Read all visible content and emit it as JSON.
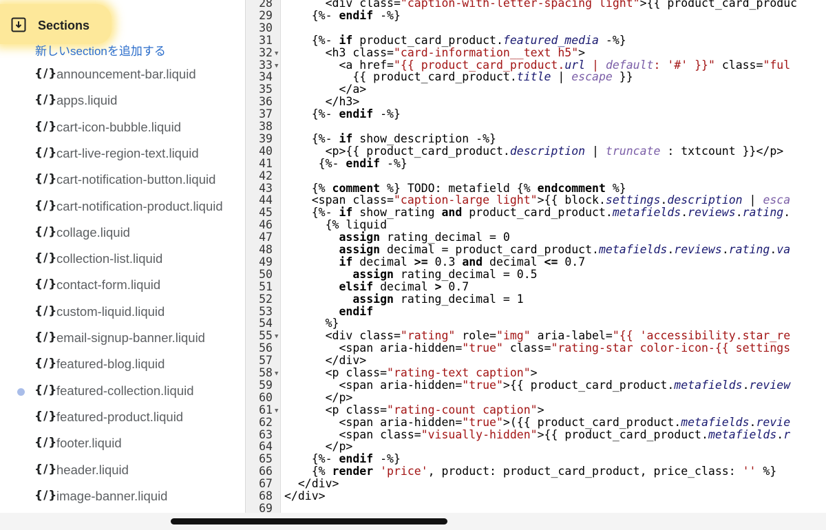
{
  "sidebar": {
    "title": "Sections",
    "add_link": "新しいsectionを追加する",
    "file_icon_text": "{/}",
    "files": [
      {
        "name": "announcement-bar.liquid",
        "modified": false
      },
      {
        "name": "apps.liquid",
        "modified": false
      },
      {
        "name": "cart-icon-bubble.liquid",
        "modified": false
      },
      {
        "name": "cart-live-region-text.liquid",
        "modified": false
      },
      {
        "name": "cart-notification-button.liquid",
        "modified": false
      },
      {
        "name": "cart-notification-product.liquid",
        "modified": false
      },
      {
        "name": "collage.liquid",
        "modified": false
      },
      {
        "name": "collection-list.liquid",
        "modified": false
      },
      {
        "name": "contact-form.liquid",
        "modified": false
      },
      {
        "name": "custom-liquid.liquid",
        "modified": false
      },
      {
        "name": "email-signup-banner.liquid",
        "modified": false
      },
      {
        "name": "featured-blog.liquid",
        "modified": false
      },
      {
        "name": "featured-collection.liquid",
        "modified": true
      },
      {
        "name": "featured-product.liquid",
        "modified": false
      },
      {
        "name": "footer.liquid",
        "modified": false
      },
      {
        "name": "header.liquid",
        "modified": false
      },
      {
        "name": "image-banner.liquid",
        "modified": false
      }
    ]
  },
  "editor": {
    "lines": [
      {
        "num": "28",
        "fold": false,
        "tokens": [
          [
            "pl",
            "      <div "
          ],
          [
            "pl",
            "class="
          ],
          [
            "str",
            "\"caption-with-letter-spacing light\""
          ],
          [
            "pl",
            ">{{ "
          ],
          [
            "pl",
            "product_card_produc"
          ]
        ]
      },
      {
        "num": "29",
        "fold": false,
        "tokens": [
          [
            "pl",
            "    {%- "
          ],
          [
            "kw",
            "endif"
          ],
          [
            "pl",
            " -%}"
          ]
        ]
      },
      {
        "num": "30",
        "fold": false,
        "tokens": []
      },
      {
        "num": "31",
        "fold": false,
        "tokens": [
          [
            "pl",
            "    {%- "
          ],
          [
            "kw",
            "if"
          ],
          [
            "pl",
            " product_card_product."
          ],
          [
            "var",
            "featured_media"
          ],
          [
            "pl",
            " -%}"
          ]
        ]
      },
      {
        "num": "32",
        "fold": true,
        "tokens": [
          [
            "pl",
            "      <h3 "
          ],
          [
            "pl",
            "class="
          ],
          [
            "str",
            "\"card-information__text h5\""
          ],
          [
            "pl",
            ">"
          ]
        ]
      },
      {
        "num": "33",
        "fold": true,
        "tokens": [
          [
            "pl",
            "        <a "
          ],
          [
            "pl",
            "href="
          ],
          [
            "str",
            "\"{{ product_card_product."
          ],
          [
            "var",
            "url"
          ],
          [
            "str",
            " | "
          ],
          [
            "fil",
            "default"
          ],
          [
            "str",
            ": '#' }}\""
          ],
          [
            "pl",
            " class="
          ],
          [
            "str",
            "\"ful"
          ]
        ]
      },
      {
        "num": "34",
        "fold": false,
        "tokens": [
          [
            "pl",
            "          {{ product_card_product."
          ],
          [
            "var",
            "title"
          ],
          [
            "pl",
            " | "
          ],
          [
            "fil",
            "escape"
          ],
          [
            "pl",
            " }}"
          ]
        ]
      },
      {
        "num": "35",
        "fold": false,
        "tokens": [
          [
            "pl",
            "        </a>"
          ]
        ]
      },
      {
        "num": "36",
        "fold": false,
        "tokens": [
          [
            "pl",
            "      </h3>"
          ]
        ]
      },
      {
        "num": "37",
        "fold": false,
        "tokens": [
          [
            "pl",
            "    {%- "
          ],
          [
            "kw",
            "endif"
          ],
          [
            "pl",
            " -%}"
          ]
        ]
      },
      {
        "num": "38",
        "fold": false,
        "tokens": []
      },
      {
        "num": "39",
        "fold": false,
        "tokens": [
          [
            "pl",
            "    {%- "
          ],
          [
            "kw",
            "if"
          ],
          [
            "pl",
            " show_description -%}"
          ]
        ]
      },
      {
        "num": "40",
        "fold": false,
        "tokens": [
          [
            "pl",
            "      <p>{{ product_card_product."
          ],
          [
            "var",
            "description"
          ],
          [
            "pl",
            " | "
          ],
          [
            "fil",
            "truncate"
          ],
          [
            "pl",
            " : txtcount }}</p>"
          ]
        ]
      },
      {
        "num": "41",
        "fold": false,
        "tokens": [
          [
            "pl",
            "     {%- "
          ],
          [
            "kw",
            "endif"
          ],
          [
            "pl",
            " -%}"
          ]
        ]
      },
      {
        "num": "42",
        "fold": false,
        "tokens": []
      },
      {
        "num": "43",
        "fold": false,
        "tokens": [
          [
            "pl",
            "    {% "
          ],
          [
            "kw",
            "comment"
          ],
          [
            "pl",
            " %} TODO: metafield {% "
          ],
          [
            "kw",
            "endcomment"
          ],
          [
            "pl",
            " %}"
          ]
        ]
      },
      {
        "num": "44",
        "fold": false,
        "tokens": [
          [
            "pl",
            "    <span "
          ],
          [
            "pl",
            "class="
          ],
          [
            "str",
            "\"caption-large light\""
          ],
          [
            "pl",
            ">{{ block."
          ],
          [
            "var",
            "settings"
          ],
          [
            "pl",
            "."
          ],
          [
            "var",
            "description"
          ],
          [
            "pl",
            " | "
          ],
          [
            "fil",
            "esca"
          ]
        ]
      },
      {
        "num": "45",
        "fold": false,
        "tokens": [
          [
            "pl",
            "    {%- "
          ],
          [
            "kw",
            "if"
          ],
          [
            "pl",
            " show_rating "
          ],
          [
            "kw",
            "and"
          ],
          [
            "pl",
            " product_card_product."
          ],
          [
            "var",
            "metafields"
          ],
          [
            "pl",
            "."
          ],
          [
            "var",
            "reviews"
          ],
          [
            "pl",
            "."
          ],
          [
            "var",
            "rating"
          ],
          [
            "pl",
            "."
          ]
        ]
      },
      {
        "num": "46",
        "fold": false,
        "tokens": [
          [
            "pl",
            "      {% liquid"
          ]
        ]
      },
      {
        "num": "47",
        "fold": false,
        "tokens": [
          [
            "pl",
            "        "
          ],
          [
            "kw",
            "assign"
          ],
          [
            "pl",
            " rating_decimal = 0"
          ]
        ]
      },
      {
        "num": "48",
        "fold": false,
        "tokens": [
          [
            "pl",
            "        "
          ],
          [
            "kw",
            "assign"
          ],
          [
            "pl",
            " decimal = product_card_product."
          ],
          [
            "var",
            "metafields"
          ],
          [
            "pl",
            "."
          ],
          [
            "var",
            "reviews"
          ],
          [
            "pl",
            "."
          ],
          [
            "var",
            "rating"
          ],
          [
            "pl",
            "."
          ],
          [
            "var",
            "va"
          ]
        ]
      },
      {
        "num": "49",
        "fold": false,
        "tokens": [
          [
            "pl",
            "        "
          ],
          [
            "kw",
            "if"
          ],
          [
            "pl",
            " decimal "
          ],
          [
            "kw",
            ">="
          ],
          [
            "pl",
            " 0.3 "
          ],
          [
            "kw",
            "and"
          ],
          [
            "pl",
            " decimal "
          ],
          [
            "kw",
            "<="
          ],
          [
            "pl",
            " 0.7"
          ]
        ]
      },
      {
        "num": "50",
        "fold": false,
        "tokens": [
          [
            "pl",
            "          "
          ],
          [
            "kw",
            "assign"
          ],
          [
            "pl",
            " rating_decimal = 0.5"
          ]
        ]
      },
      {
        "num": "51",
        "fold": false,
        "tokens": [
          [
            "pl",
            "        "
          ],
          [
            "kw",
            "elsif"
          ],
          [
            "pl",
            " decimal "
          ],
          [
            "kw",
            ">"
          ],
          [
            "pl",
            " 0.7"
          ]
        ]
      },
      {
        "num": "52",
        "fold": false,
        "tokens": [
          [
            "pl",
            "          "
          ],
          [
            "kw",
            "assign"
          ],
          [
            "pl",
            " rating_decimal = 1"
          ]
        ]
      },
      {
        "num": "53",
        "fold": false,
        "tokens": [
          [
            "pl",
            "        "
          ],
          [
            "kw",
            "endif"
          ]
        ]
      },
      {
        "num": "54",
        "fold": false,
        "tokens": [
          [
            "pl",
            "      %}"
          ]
        ]
      },
      {
        "num": "55",
        "fold": true,
        "tokens": [
          [
            "pl",
            "      <div "
          ],
          [
            "pl",
            "class="
          ],
          [
            "str",
            "\"rating\""
          ],
          [
            "pl",
            " role="
          ],
          [
            "str",
            "\"img\""
          ],
          [
            "pl",
            " aria-label="
          ],
          [
            "str",
            "\"{{ 'accessibility.star_re"
          ]
        ]
      },
      {
        "num": "56",
        "fold": false,
        "tokens": [
          [
            "pl",
            "        <span "
          ],
          [
            "pl",
            "aria-hidden="
          ],
          [
            "str",
            "\"true\""
          ],
          [
            "pl",
            " class="
          ],
          [
            "str",
            "\"rating-star color-icon-{{ settings"
          ]
        ]
      },
      {
        "num": "57",
        "fold": false,
        "tokens": [
          [
            "pl",
            "      </div>"
          ]
        ]
      },
      {
        "num": "58",
        "fold": true,
        "tokens": [
          [
            "pl",
            "      <p "
          ],
          [
            "pl",
            "class="
          ],
          [
            "str",
            "\"rating-text caption\""
          ],
          [
            "pl",
            ">"
          ]
        ]
      },
      {
        "num": "59",
        "fold": false,
        "tokens": [
          [
            "pl",
            "        <span "
          ],
          [
            "pl",
            "aria-hidden="
          ],
          [
            "str",
            "\"true\""
          ],
          [
            "pl",
            ">{{ product_card_product."
          ],
          [
            "var",
            "metafields"
          ],
          [
            "pl",
            "."
          ],
          [
            "var",
            "review"
          ]
        ]
      },
      {
        "num": "60",
        "fold": false,
        "tokens": [
          [
            "pl",
            "      </p>"
          ]
        ]
      },
      {
        "num": "61",
        "fold": true,
        "tokens": [
          [
            "pl",
            "      <p "
          ],
          [
            "pl",
            "class="
          ],
          [
            "str",
            "\"rating-count caption\""
          ],
          [
            "pl",
            ">"
          ]
        ]
      },
      {
        "num": "62",
        "fold": false,
        "tokens": [
          [
            "pl",
            "        <span "
          ],
          [
            "pl",
            "aria-hidden="
          ],
          [
            "str",
            "\"true\""
          ],
          [
            "pl",
            ">({{ product_card_product."
          ],
          [
            "var",
            "metafields"
          ],
          [
            "pl",
            "."
          ],
          [
            "var",
            "revie"
          ]
        ]
      },
      {
        "num": "63",
        "fold": false,
        "tokens": [
          [
            "pl",
            "        <span "
          ],
          [
            "pl",
            "class="
          ],
          [
            "str",
            "\"visually-hidden\""
          ],
          [
            "pl",
            ">{{ product_card_product."
          ],
          [
            "var",
            "metafields"
          ],
          [
            "pl",
            "."
          ],
          [
            "var",
            "r"
          ]
        ]
      },
      {
        "num": "64",
        "fold": false,
        "tokens": [
          [
            "pl",
            "      </p>"
          ]
        ]
      },
      {
        "num": "65",
        "fold": false,
        "tokens": [
          [
            "pl",
            "    {%- "
          ],
          [
            "kw",
            "endif"
          ],
          [
            "pl",
            " -%}"
          ]
        ]
      },
      {
        "num": "66",
        "fold": false,
        "tokens": [
          [
            "pl",
            "    {% "
          ],
          [
            "kw",
            "render"
          ],
          [
            "pl",
            " "
          ],
          [
            "str",
            "'price'"
          ],
          [
            "pl",
            ", product: product_card_product, price_class: "
          ],
          [
            "str",
            "''"
          ],
          [
            "pl",
            " %}"
          ]
        ]
      },
      {
        "num": "67",
        "fold": false,
        "tokens": [
          [
            "pl",
            "  </div>"
          ]
        ]
      },
      {
        "num": "68",
        "fold": false,
        "tokens": [
          [
            "pl",
            "</div>"
          ]
        ]
      },
      {
        "num": "69",
        "fold": false,
        "tokens": []
      }
    ]
  },
  "colors": {
    "highlight": "#fde89a",
    "link": "#2c6ecb",
    "modified_dot": "#a9bde9",
    "string": "#a31515",
    "filter": "#7b5ea7"
  },
  "icons": {
    "section_header": "folder-download-icon",
    "file": "liquid-file-icon",
    "fold": "fold-arrow-icon"
  }
}
